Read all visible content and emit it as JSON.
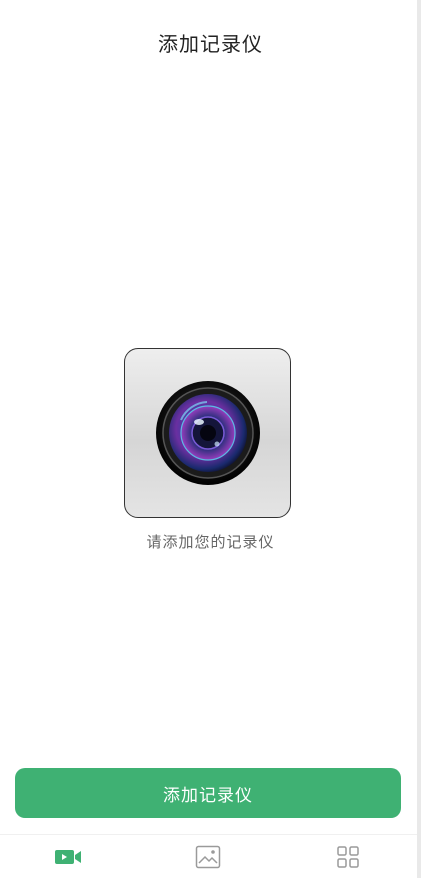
{
  "header": {
    "title": "添加记录仪"
  },
  "empty_state": {
    "device_icon": "camera-lens-icon",
    "hint": "请添加您的记录仪"
  },
  "actions": {
    "add_label": "添加记录仪"
  },
  "tabbar": {
    "tabs": [
      {
        "icon": "video-camera-icon",
        "active": true
      },
      {
        "icon": "image-icon",
        "active": false
      },
      {
        "icon": "grid-apps-icon",
        "active": false
      }
    ]
  },
  "colors": {
    "accent": "#3fb173",
    "tab_inactive": "#9a9a9a",
    "title_text": "#222222",
    "hint_text": "#666666"
  }
}
